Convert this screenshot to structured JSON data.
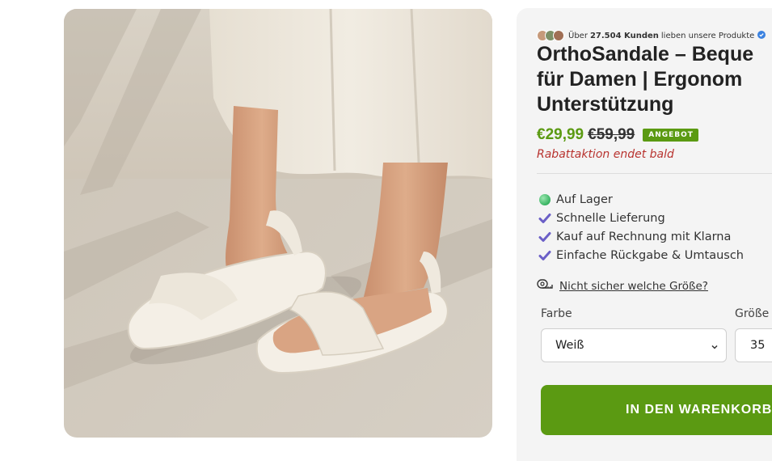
{
  "social_proof": {
    "prefix": "Über",
    "count": "27.504 Kunden",
    "suffix": "lieben unsere Produkte"
  },
  "product": {
    "title_lines": [
      "OrthoSandale – Beque",
      "für Damen | Ergonom",
      "Unterstützung"
    ],
    "price_current": "€29,99",
    "price_old": "€59,99",
    "badge": "ANGEBOT",
    "promo": "Rabattaktion endet bald"
  },
  "features": [
    {
      "label": "Auf Lager",
      "icon": "in-stock-dot-icon"
    },
    {
      "label": "Schnelle Lieferung",
      "icon": "check-icon"
    },
    {
      "label": "Kauf auf Rechnung mit Klarna",
      "icon": "check-icon"
    },
    {
      "label": "Einfache Rückgabe & Umtausch",
      "icon": "check-icon"
    }
  ],
  "size_guide": {
    "label": "Nicht sicher welche Größe?"
  },
  "options": {
    "color_label": "Farbe",
    "color_value": "Weiß",
    "size_label": "Größe",
    "size_value": "35"
  },
  "cart_button": {
    "label": "IN DEN WARENKORB"
  },
  "colors": {
    "accent_green": "#5b9a12",
    "promo_red": "#b8332f",
    "check_purple": "#6b5fc7"
  }
}
